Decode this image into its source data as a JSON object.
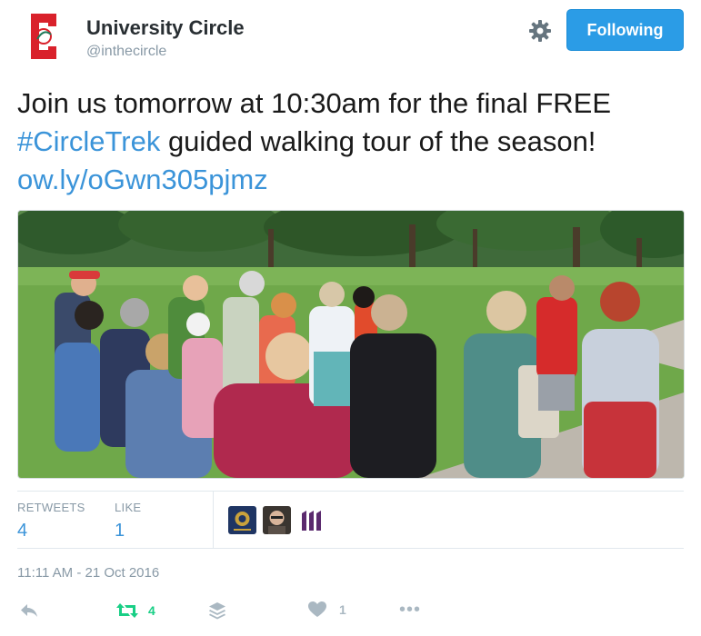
{
  "account": {
    "name": "University Circle",
    "handle": "@inthecircle"
  },
  "follow_button": {
    "label": "Following"
  },
  "tweet": {
    "text_before": "Join us tomorrow at 10:30am for the final FREE ",
    "hashtag": "#CircleTrek",
    "text_after": " guided walking tour of the season! ",
    "link": "ow.ly/oGwn305pjmz"
  },
  "stats": {
    "retweets_label": "RETWEETS",
    "retweets_value": "4",
    "likes_label": "LIKE",
    "likes_value": "1"
  },
  "timestamp": "11:11 AM - 21 Oct 2016",
  "actions": {
    "retweet_count": "4",
    "like_count": "1",
    "more_label": "•••"
  },
  "colors": {
    "accent": "#3b94d9",
    "follow_button": "#2b9ce6",
    "retweet_active": "#19cf86",
    "muted": "#8899a6",
    "brand_red": "#d9212b"
  }
}
